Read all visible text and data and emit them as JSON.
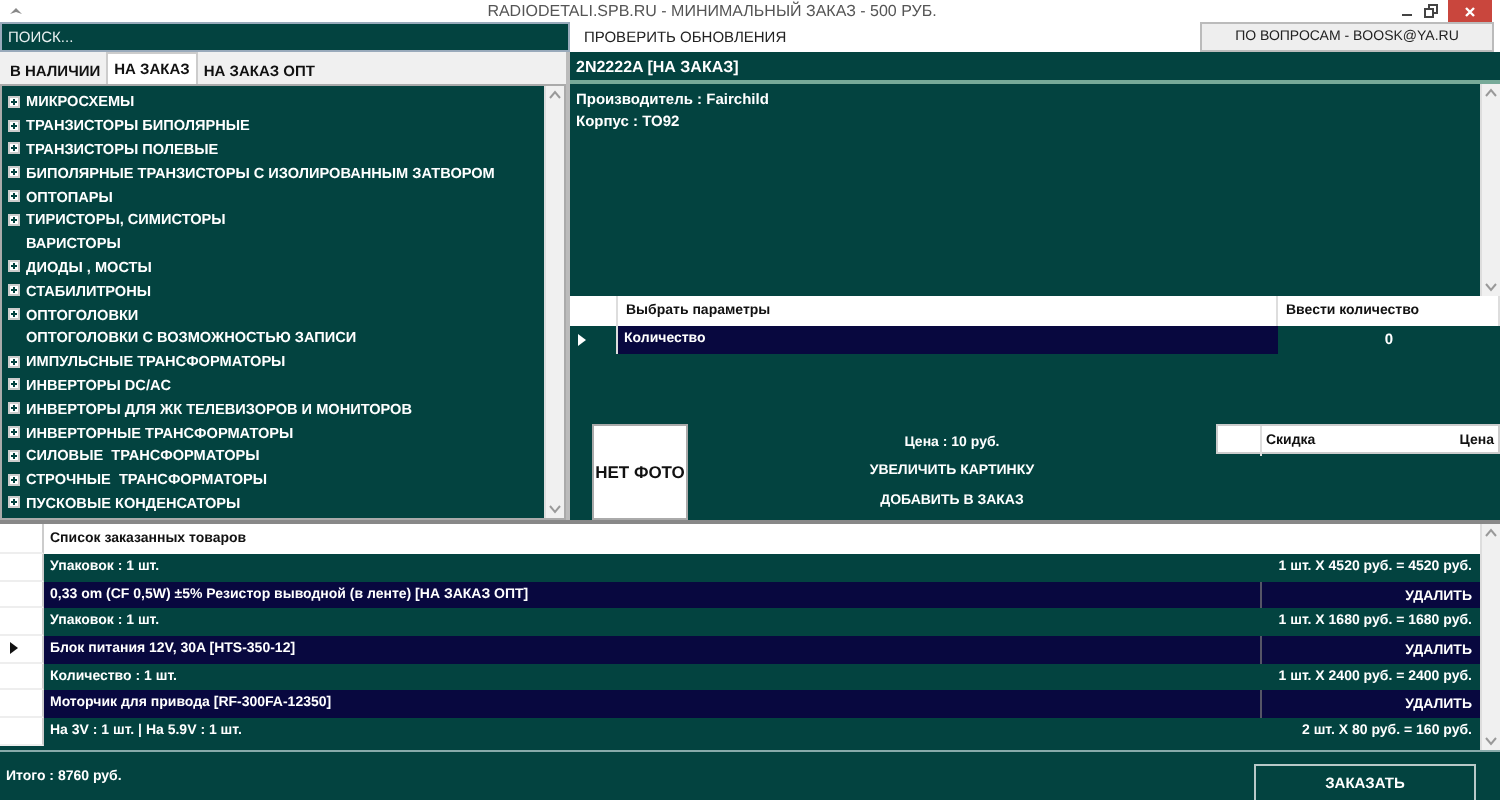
{
  "window": {
    "title": "RADIODETALI.SPB.RU - МИНИМАЛЬНЫЙ ЗАКАЗ - 500 РУБ."
  },
  "search": {
    "placeholder": "ПОИСК..."
  },
  "toolbar": {
    "update_button": "ПРОВЕРИТЬ ОБНОВЛЕНИЯ",
    "contact_button": "ПО ВОПРОСАМ - BOOSK@YA.RU"
  },
  "tabs": [
    {
      "label": "В НАЛИЧИИ",
      "selected": false
    },
    {
      "label": "НА ЗАКАЗ",
      "selected": true
    },
    {
      "label": "НА ЗАКАЗ ОПТ",
      "selected": false
    }
  ],
  "categories": [
    {
      "label": "МИКРОСХЕМЫ",
      "expandable": true
    },
    {
      "label": "ТРАНЗИСТОРЫ БИПОЛЯРНЫЕ",
      "expandable": true
    },
    {
      "label": "ТРАНЗИСТОРЫ ПОЛЕВЫЕ",
      "expandable": true
    },
    {
      "label": "БИПОЛЯРНЫЕ ТРАНЗИСТОРЫ С ИЗОЛИРОВАННЫМ ЗАТВОРОМ",
      "expandable": true
    },
    {
      "label": "ОПТОПАРЫ",
      "expandable": true
    },
    {
      "label": "ТИРИСТОРЫ, СИМИСТОРЫ",
      "expandable": true
    },
    {
      "label": "ВАРИСТОРЫ",
      "expandable": false
    },
    {
      "label": "ДИОДЫ , МОСТЫ",
      "expandable": true
    },
    {
      "label": "СТАБИЛИТРОНЫ",
      "expandable": true
    },
    {
      "label": "ОПТОГОЛОВКИ",
      "expandable": true
    },
    {
      "label": "ОПТОГОЛОВКИ С ВОЗМОЖНОСТЬЮ ЗАПИСИ",
      "expandable": false
    },
    {
      "label": "ИМПУЛЬСНЫЕ ТРАНСФОРМАТОРЫ",
      "expandable": true
    },
    {
      "label": "ИНВЕРТОРЫ DC/AC",
      "expandable": true
    },
    {
      "label": "ИНВЕРТОРЫ ДЛЯ ЖК ТЕЛЕВИЗОРОВ И МОНИТОРОВ",
      "expandable": true
    },
    {
      "label": "ИНВЕРТОРНЫЕ ТРАНСФОРМАТОРЫ",
      "expandable": true
    },
    {
      "label": "СИЛОВЫЕ  ТРАНСФОРМАТОРЫ",
      "expandable": true
    },
    {
      "label": "СТРОЧНЫЕ  ТРАНСФОРМАТОРЫ",
      "expandable": true
    },
    {
      "label": "ПУСКОВЫЕ КОНДЕНСАТОРЫ",
      "expandable": true
    }
  ],
  "product": {
    "title": "2N2222A [НА ЗАКАЗ]",
    "details": [
      "Производитель : Fairchild",
      "Корпус : TO92"
    ],
    "parameters": {
      "columns": [
        "Выбрать параметры",
        "Ввести количество"
      ],
      "rows": [
        {
          "name": "Количество",
          "value": "0",
          "selected": true
        }
      ]
    },
    "photo": "НЕТ ФОТО",
    "price": "Цена : 10 руб.",
    "enlarge_button": "УВЕЛИЧИТЬ КАРТИНКУ",
    "add_button": "ДОБАВИТЬ В ЗАКАЗ",
    "discounts": {
      "columns": [
        "Скидка",
        "Цена"
      ]
    }
  },
  "orders": {
    "header": "Список заказанных товаров",
    "rows": [
      {
        "kind": "quantity",
        "text": "Упаковок : 1 шт.",
        "amount": "1 шт. X 4520 руб. =  4520 руб.",
        "selected": false
      },
      {
        "kind": "item",
        "text": "0,33 om (CF 0,5W) ±5% Резистор выводной (в ленте) [НА ЗАКАЗ ОПТ]",
        "action": "УДАЛИТЬ",
        "selected": false
      },
      {
        "kind": "quantity",
        "text": "Упаковок : 1 шт.",
        "amount": "1 шт. X 1680 руб. =  1680 руб.",
        "selected": false
      },
      {
        "kind": "item",
        "text": "Блок питания 12V, 30A [HTS-350-12]",
        "action": "УДАЛИТЬ",
        "selected": true
      },
      {
        "kind": "quantity",
        "text": "Количество : 1 шт.",
        "amount": "1 шт. X 2400 руб. =  2400 руб.",
        "selected": false
      },
      {
        "kind": "item",
        "text": "Моторчик для привода [RF-300FA-12350]",
        "action": "УДАЛИТЬ",
        "selected": false
      },
      {
        "kind": "quantity",
        "text": "На 3V : 1 шт. | На 5.9V : 1 шт.",
        "amount": "2 шт. X 80 руб. =  160 руб.",
        "selected": false
      }
    ]
  },
  "footer": {
    "total": "Итого : 8760 руб.",
    "order_button": "ЗАКАЗАТЬ"
  }
}
